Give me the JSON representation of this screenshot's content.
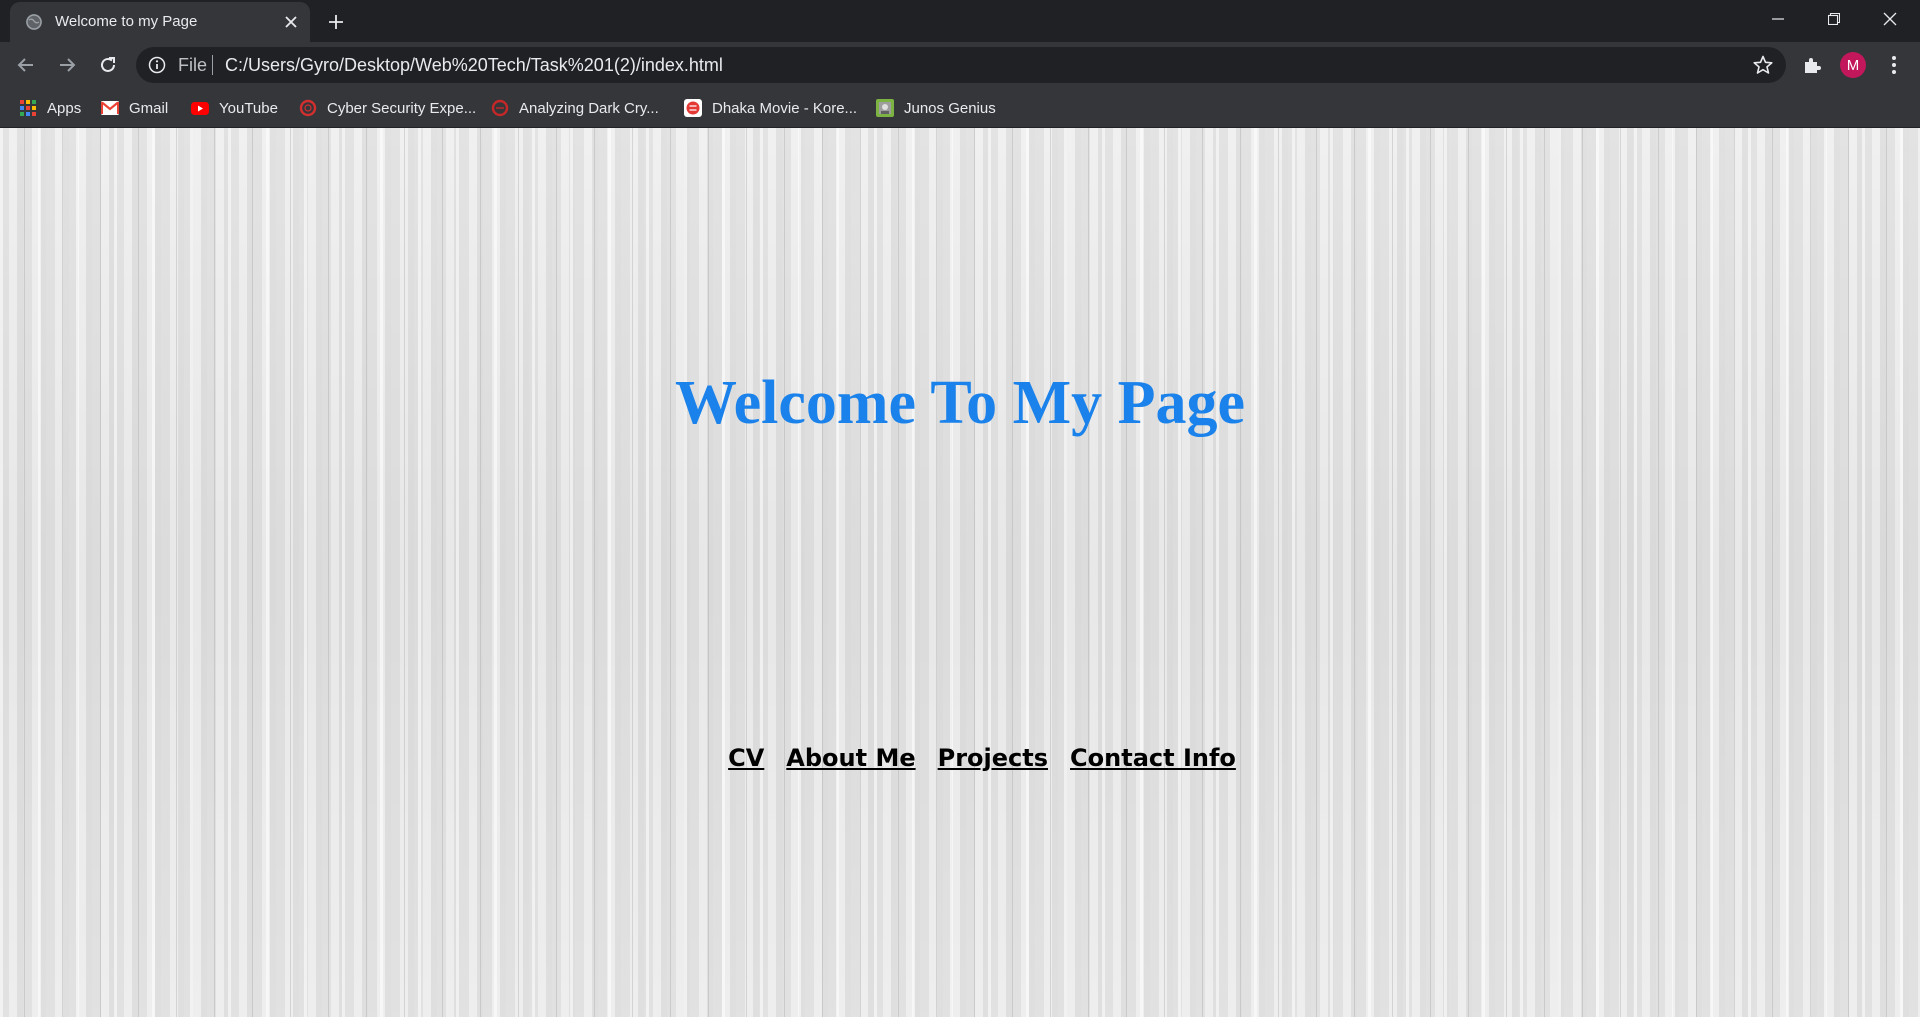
{
  "tab": {
    "title": "Welcome to my Page"
  },
  "omnibox": {
    "scheme": "File",
    "url": "C:/Users/Gyro/Desktop/Web%20Tech/Task%201(2)/index.html"
  },
  "profile": {
    "initial": "M",
    "color": "#c2185b"
  },
  "bookmarks": [
    {
      "label": "Apps",
      "icon": "apps-grid-icon"
    },
    {
      "label": "Gmail",
      "icon": "gmail-icon"
    },
    {
      "label": "YouTube",
      "icon": "youtube-icon"
    },
    {
      "label": "Cyber Security Expe...",
      "icon": "cyber-security-icon"
    },
    {
      "label": "Analyzing Dark Cry...",
      "icon": "dark-crypto-icon"
    },
    {
      "label": "Dhaka Movie - Kore...",
      "icon": "dhaka-movie-icon"
    },
    {
      "label": "Junos Genius",
      "icon": "junos-genius-icon"
    }
  ],
  "page": {
    "heading": "Welcome To My Page",
    "heading_color": "#1a82ea",
    "links": [
      "CV",
      "About Me",
      "Projects",
      "Contact Info"
    ]
  }
}
